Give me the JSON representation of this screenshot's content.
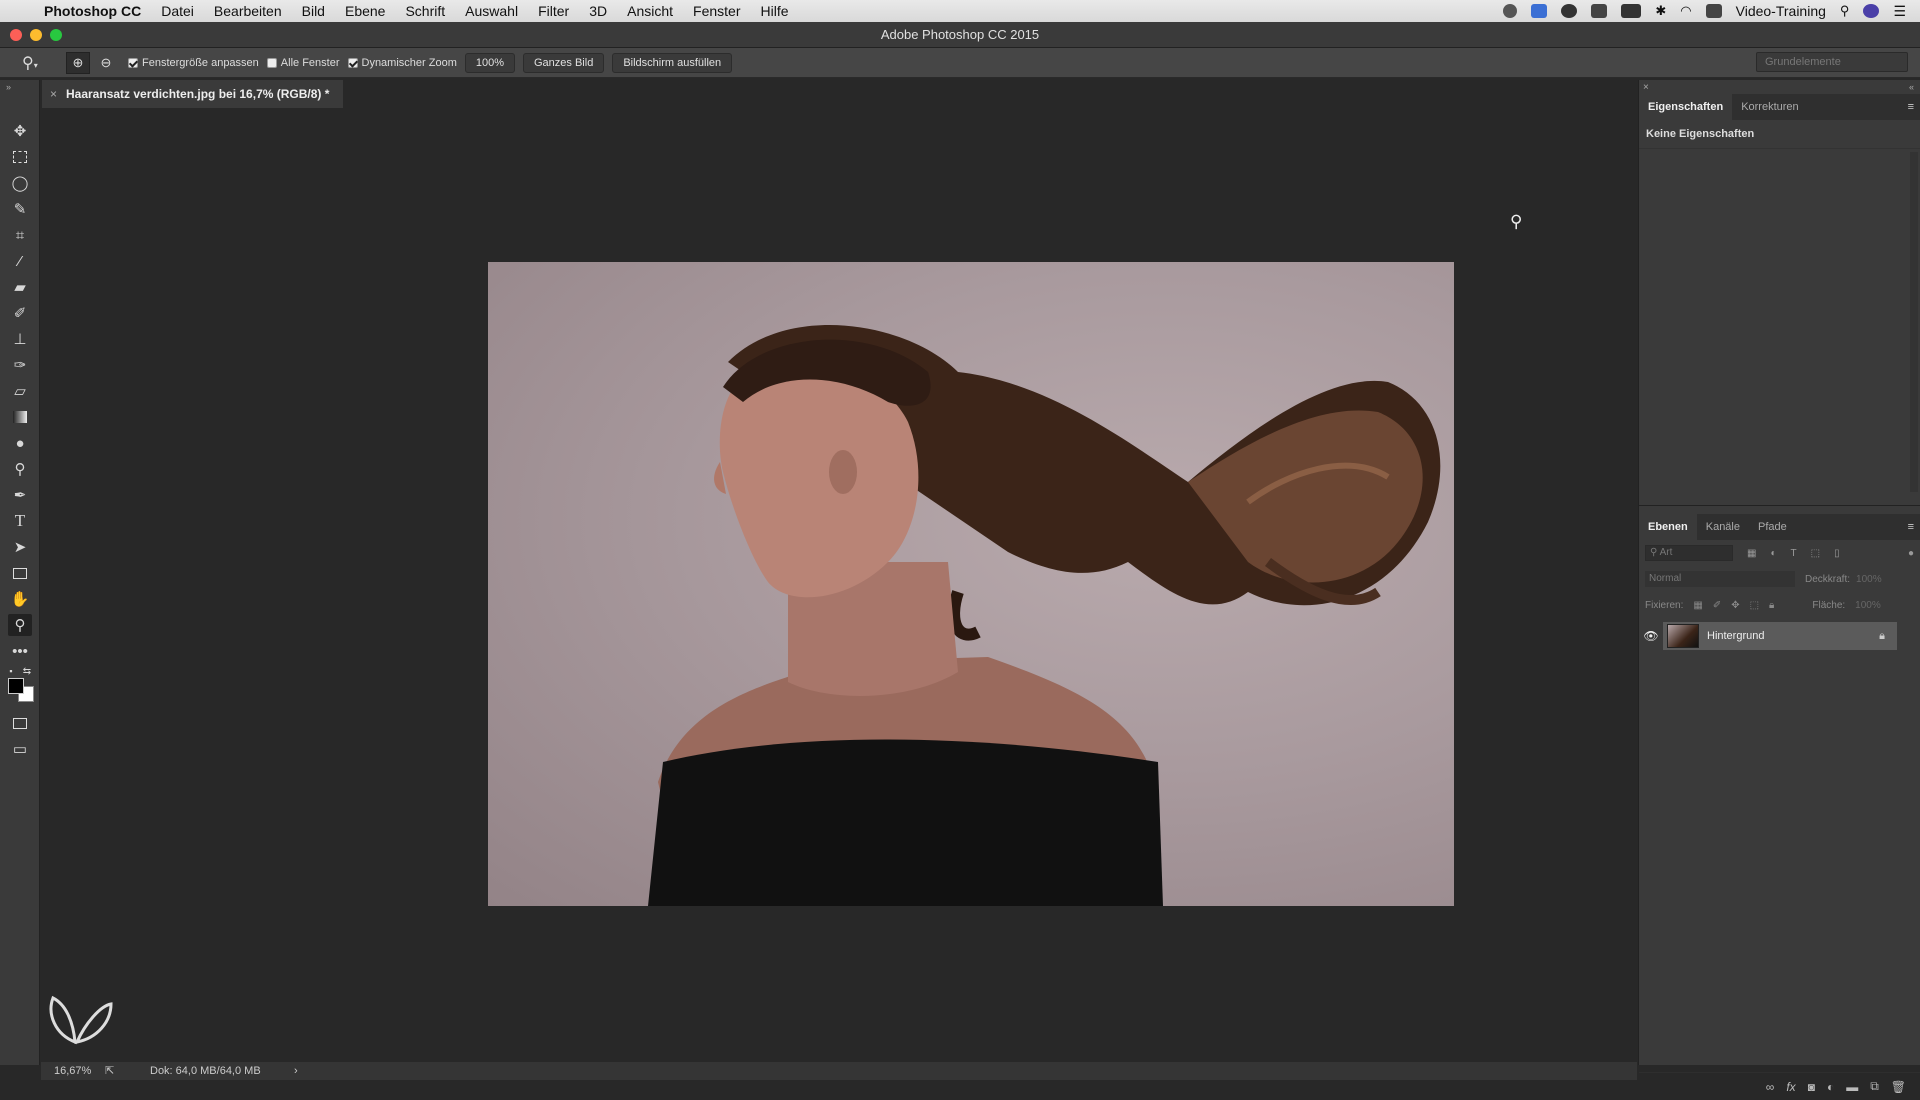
{
  "menubar": {
    "app_name": "Photoshop CC",
    "items": [
      "Datei",
      "Bearbeiten",
      "Bild",
      "Ebene",
      "Schrift",
      "Auswahl",
      "Filter",
      "3D",
      "Ansicht",
      "Fenster",
      "Hilfe"
    ],
    "user": "Video-Training"
  },
  "window": {
    "title": "Adobe Photoshop CC 2015"
  },
  "options": {
    "fit_window_label": "Fenstergröße anpassen",
    "fit_window_checked": true,
    "all_windows_label": "Alle Fenster",
    "all_windows_checked": false,
    "dynamic_zoom_label": "Dynamischer Zoom",
    "dynamic_zoom_checked": true,
    "zoom_value": "100%",
    "fit_screen_label": "Ganzes Bild",
    "fill_screen_label": "Bildschirm ausfüllen",
    "workspace": "Grundelemente"
  },
  "document": {
    "tab_title": "Haaransatz verdichten.jpg bei 16,7% (RGB/8) *"
  },
  "properties": {
    "tabs": [
      "Eigenschaften",
      "Korrekturen"
    ],
    "active_tab": "Eigenschaften",
    "message": "Keine Eigenschaften"
  },
  "layers": {
    "tabs": [
      "Ebenen",
      "Kanäle",
      "Pfade"
    ],
    "active_tab": "Ebenen",
    "filter_placeholder": "Art",
    "blend_mode": "Normal",
    "opacity_label": "Deckkraft:",
    "opacity_value": "100%",
    "lock_label": "Fixieren:",
    "fill_label": "Fläche:",
    "fill_value": "100%",
    "items": [
      {
        "name": "Hintergrund",
        "visible": true,
        "locked": true
      }
    ]
  },
  "status": {
    "zoom": "16,67%",
    "doc_size": "Dok: 64,0 MB/64,0 MB"
  },
  "colors": {
    "accent": "#4a90d9",
    "foreground": "#000000",
    "background": "#ffffff"
  }
}
